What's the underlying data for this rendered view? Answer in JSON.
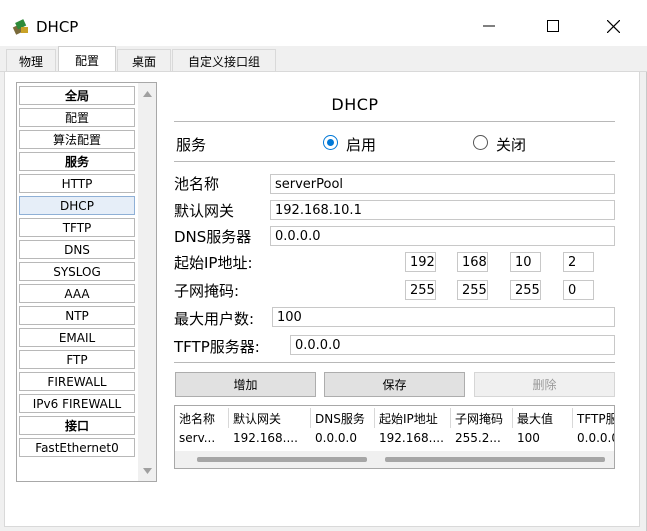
{
  "window": {
    "title": "DHCP"
  },
  "tabs": [
    {
      "label": "物理"
    },
    {
      "label": "配置"
    },
    {
      "label": "桌面"
    },
    {
      "label": "自定义接口组"
    }
  ],
  "active_tab": "配置",
  "sidebar": {
    "items": [
      {
        "label": "全局",
        "bold": true
      },
      {
        "label": "配置"
      },
      {
        "label": "算法配置"
      },
      {
        "label": "服务",
        "bold": true
      },
      {
        "label": "HTTP"
      },
      {
        "label": "DHCP",
        "selected": true
      },
      {
        "label": "TFTP"
      },
      {
        "label": "DNS"
      },
      {
        "label": "SYSLOG"
      },
      {
        "label": "AAA"
      },
      {
        "label": "NTP"
      },
      {
        "label": "EMAIL"
      },
      {
        "label": "FTP"
      },
      {
        "label": "FIREWALL"
      },
      {
        "label": "IPv6 FIREWALL"
      },
      {
        "label": "接口",
        "bold": true
      },
      {
        "label": "FastEthernet0"
      }
    ]
  },
  "panel": {
    "heading": "DHCP",
    "service_label": "服务",
    "radio_on_label": "启用",
    "radio_off_label": "关闭",
    "service_state": "启用",
    "pool_name_label": "池名称",
    "pool_name_value": "serverPool",
    "gateway_label": "默认网关",
    "gateway_value": "192.168.10.1",
    "dns_label": "DNS服务器",
    "dns_value": "0.0.0.0",
    "start_ip_label": "起始IP地址:",
    "start_ip": [
      "192",
      "168",
      "10",
      "2"
    ],
    "mask_label": "子网掩码:",
    "mask": [
      "255",
      "255",
      "255",
      "0"
    ],
    "max_users_label": "最大用户数:",
    "max_users_value": "100",
    "tftp_label": "TFTP服务器:",
    "tftp_value": "0.0.0.0",
    "add_button": "增加",
    "save_button": "保存",
    "delete_button": "删除"
  },
  "table": {
    "headers": [
      "池名称",
      "默认网关",
      "DNS服务",
      "起始IP地址",
      "子网掩码",
      "最大值",
      "TFTP服"
    ],
    "rows": [
      [
        "serv...",
        "192.168....",
        "0.0.0.0",
        "192.168....",
        "255.2...",
        "100",
        "0.0.0.0"
      ]
    ]
  },
  "colors": {
    "accent": "#0078d7",
    "selected_item_bg": "#e6eef8"
  }
}
